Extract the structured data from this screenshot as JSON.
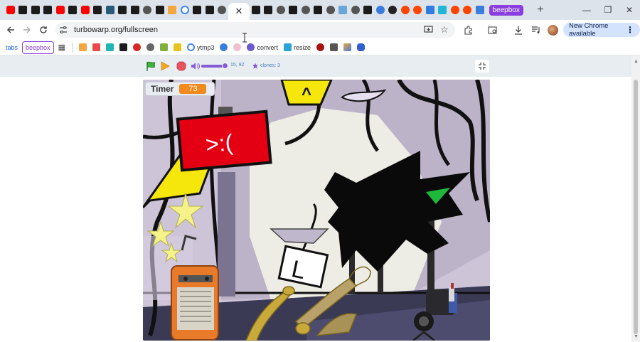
{
  "tabbar": {
    "close_glyph": "✕",
    "new_tab_glyph": "+",
    "label_tab": "beepbox",
    "window": {
      "minimize": "—",
      "restore": "❐",
      "close": "✕"
    }
  },
  "toolbar": {
    "url": "turbowarp.org/fullscreen",
    "update_label": "New Chrome available"
  },
  "bookmarks": {
    "tabs": "tabs",
    "beepbox": "beepbox",
    "ytmp3": "ytmp3",
    "convert": "convert",
    "resize": "resize"
  },
  "controls": {
    "mouse_pos": "15, 92",
    "clones": "clones: 3"
  },
  "stage": {
    "timer_label": "Timer",
    "timer_value": "73",
    "sign_text": ">:(",
    "arrow_glyph": "^",
    "card_letter": "L"
  },
  "colors": {
    "accent": "#8a3ee0",
    "timer_value_bg": "#f28a1e",
    "sign_red": "#e40012",
    "sign_yellow": "#f5e60b",
    "flag_green": "#3fb13c",
    "stop_red": "#e6525d"
  }
}
